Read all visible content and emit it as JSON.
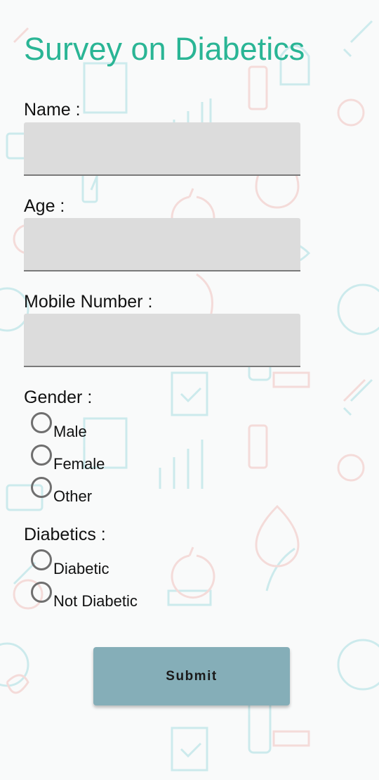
{
  "title": "Survey on Diabetics",
  "colors": {
    "title": "#2ab595",
    "button": "#85aeb8",
    "field_bg": "#dcdcdc"
  },
  "fields": {
    "name_label": "Name :",
    "name_value": "",
    "age_label": "Age :",
    "age_value": "",
    "mobile_label": "Mobile Number :",
    "mobile_value": ""
  },
  "gender": {
    "label": "Gender :",
    "options": [
      "Male",
      "Female",
      "Other"
    ],
    "selected": null
  },
  "diabetics": {
    "label": "Diabetics :",
    "options": [
      "Diabetic",
      "Not Diabetic"
    ],
    "selected": null
  },
  "submit_label": "Submit",
  "background_icons": [
    "apple-icon",
    "heart-icon",
    "syringe-icon",
    "pills-icon",
    "chart-icon",
    "blood-drop-icon",
    "glucose-meter-icon",
    "stethoscope-icon"
  ]
}
